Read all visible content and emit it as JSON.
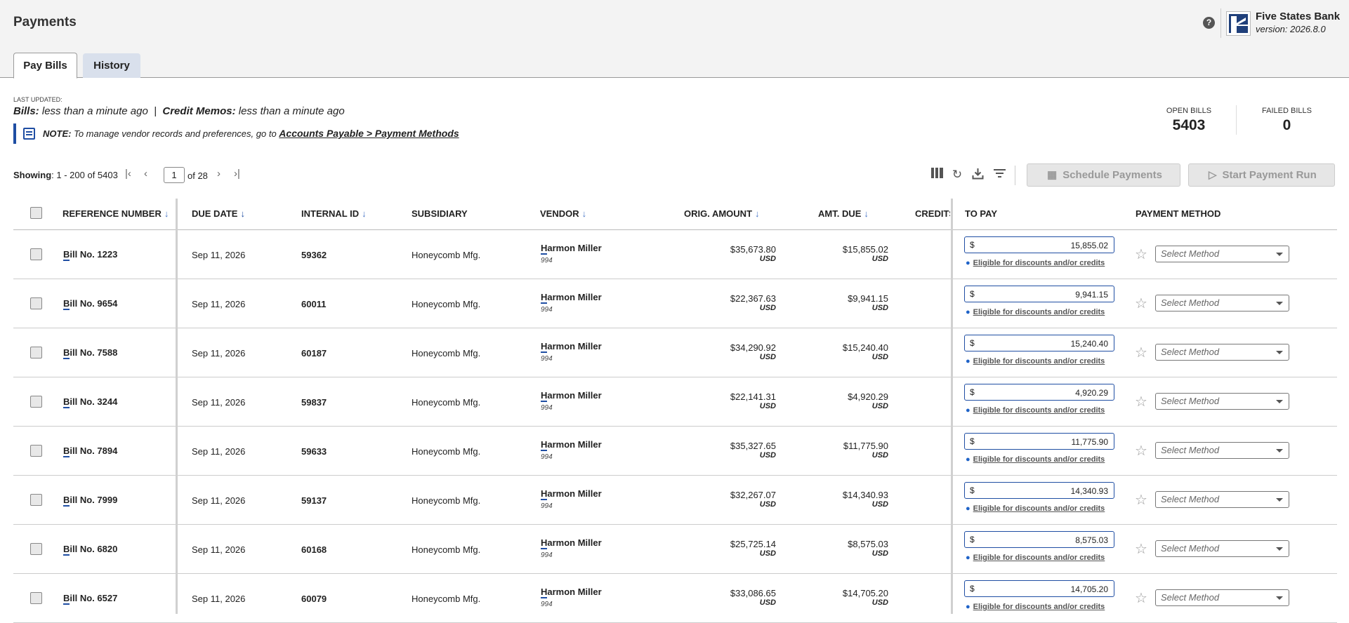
{
  "header": {
    "title": "Payments",
    "bank_name": "Five States Bank",
    "bank_version": "version: 2026.8.0"
  },
  "tabs": [
    {
      "label": "Pay Bills",
      "active": true
    },
    {
      "label": "History",
      "active": false
    }
  ],
  "status": {
    "last_updated_label": "LAST UPDATED:",
    "bills_label": "Bills:",
    "bills_value": "less than a minute ago",
    "separator": "|",
    "memos_label": "Credit Memos:",
    "memos_value": "less than a minute ago"
  },
  "note": {
    "prefix": "NOTE:",
    "text": "To manage vendor records and preferences, go to",
    "link": "Accounts Payable > Payment Methods"
  },
  "stats": {
    "open_label": "OPEN BILLS",
    "open_value": "5403",
    "failed_label": "FAILED BILLS",
    "failed_value": "0"
  },
  "pagination": {
    "showing_label": "Showing",
    "showing_range": ": 1 - 200 of 5403",
    "page": "1",
    "of_pages": "of 28"
  },
  "actions": {
    "schedule": "Schedule Payments",
    "start_run": "Start Payment Run"
  },
  "columns": {
    "ref": "REFERENCE NUMBER",
    "due": "DUE DATE",
    "internal": "INTERNAL ID",
    "subsidiary": "SUBSIDIARY",
    "vendor": "VENDOR",
    "orig": "ORIG. AMOUNT",
    "due_amt": "AMT. DUE",
    "credits": "CREDITS",
    "to_pay": "TO PAY",
    "method": "PAYMENT METHOD"
  },
  "common": {
    "currency_symbol": "$",
    "eligible_text": "Eligible for discounts and/or credits",
    "select_placeholder": "Select Method"
  },
  "rows": [
    {
      "ref_first": "B",
      "ref_rest": "ill No. 1223",
      "due": "Sep 11, 2026",
      "internal": "59362",
      "subsidiary": "Honeycomb Mfg.",
      "vendor_first": "H",
      "vendor_rest": "armon Miller",
      "vendor_id": "994",
      "orig": "$35,673.80",
      "orig_cur": "USD",
      "amt_due": "$15,855.02",
      "amt_cur": "USD",
      "to_pay": "15,855.02"
    },
    {
      "ref_first": "B",
      "ref_rest": "ill No. 9654",
      "due": "Sep 11, 2026",
      "internal": "60011",
      "subsidiary": "Honeycomb Mfg.",
      "vendor_first": "H",
      "vendor_rest": "armon Miller",
      "vendor_id": "994",
      "orig": "$22,367.63",
      "orig_cur": "USD",
      "amt_due": "$9,941.15",
      "amt_cur": "USD",
      "to_pay": "9,941.15"
    },
    {
      "ref_first": "B",
      "ref_rest": "ill No. 7588",
      "due": "Sep 11, 2026",
      "internal": "60187",
      "subsidiary": "Honeycomb Mfg.",
      "vendor_first": "H",
      "vendor_rest": "armon Miller",
      "vendor_id": "994",
      "orig": "$34,290.92",
      "orig_cur": "USD",
      "amt_due": "$15,240.40",
      "amt_cur": "USD",
      "to_pay": "15,240.40"
    },
    {
      "ref_first": "B",
      "ref_rest": "ill No. 3244",
      "due": "Sep 11, 2026",
      "internal": "59837",
      "subsidiary": "Honeycomb Mfg.",
      "vendor_first": "H",
      "vendor_rest": "armon Miller",
      "vendor_id": "994",
      "orig": "$22,141.31",
      "orig_cur": "USD",
      "amt_due": "$4,920.29",
      "amt_cur": "USD",
      "to_pay": "4,920.29"
    },
    {
      "ref_first": "B",
      "ref_rest": "ill No. 7894",
      "due": "Sep 11, 2026",
      "internal": "59633",
      "subsidiary": "Honeycomb Mfg.",
      "vendor_first": "H",
      "vendor_rest": "armon Miller",
      "vendor_id": "994",
      "orig": "$35,327.65",
      "orig_cur": "USD",
      "amt_due": "$11,775.90",
      "amt_cur": "USD",
      "to_pay": "11,775.90"
    },
    {
      "ref_first": "B",
      "ref_rest": "ill No. 7999",
      "due": "Sep 11, 2026",
      "internal": "59137",
      "subsidiary": "Honeycomb Mfg.",
      "vendor_first": "H",
      "vendor_rest": "armon Miller",
      "vendor_id": "994",
      "orig": "$32,267.07",
      "orig_cur": "USD",
      "amt_due": "$14,340.93",
      "amt_cur": "USD",
      "to_pay": "14,340.93"
    },
    {
      "ref_first": "B",
      "ref_rest": "ill No. 6820",
      "due": "Sep 11, 2026",
      "internal": "60168",
      "subsidiary": "Honeycomb Mfg.",
      "vendor_first": "H",
      "vendor_rest": "armon Miller",
      "vendor_id": "994",
      "orig": "$25,725.14",
      "orig_cur": "USD",
      "amt_due": "$8,575.03",
      "amt_cur": "USD",
      "to_pay": "8,575.03"
    },
    {
      "ref_first": "B",
      "ref_rest": "ill No. 6527",
      "due": "Sep 11, 2026",
      "internal": "60079",
      "subsidiary": "Honeycomb Mfg.",
      "vendor_first": "H",
      "vendor_rest": "armon Miller",
      "vendor_id": "994",
      "orig": "$33,086.65",
      "orig_cur": "USD",
      "amt_due": "$14,705.20",
      "amt_cur": "USD",
      "to_pay": "14,705.20"
    }
  ]
}
